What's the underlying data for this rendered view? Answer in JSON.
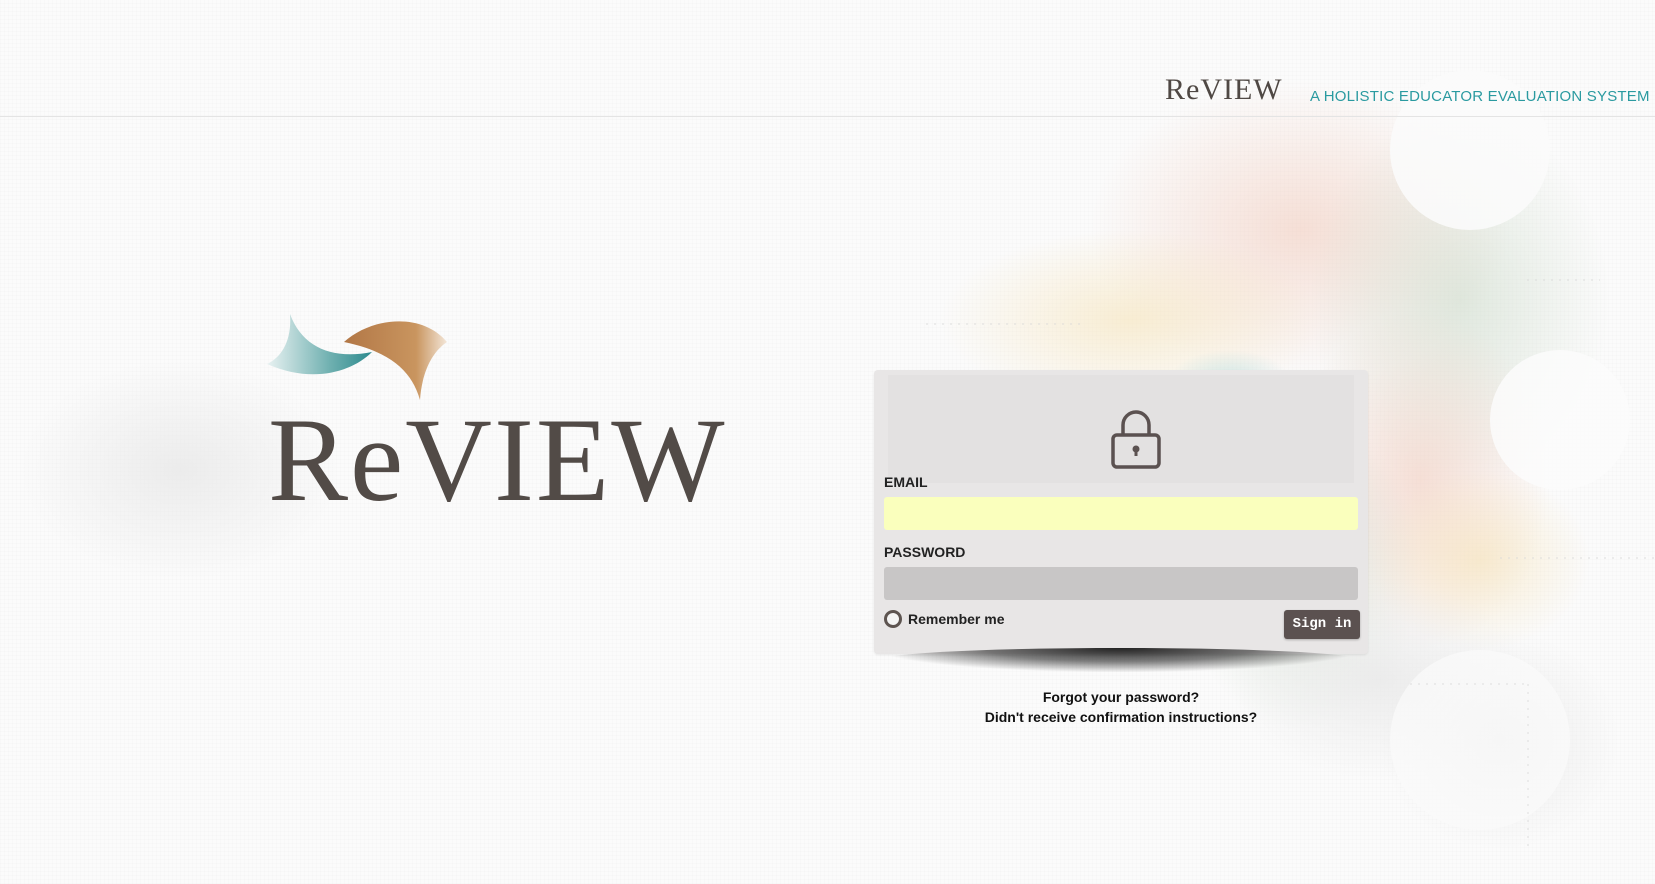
{
  "header": {
    "logo_text": "ReVIEW",
    "tagline": "A HOLISTIC EDUCATOR EVALUATION SYSTEM"
  },
  "hero": {
    "logo_text": "ReVIEW"
  },
  "login": {
    "email_label": "EMAIL",
    "email_value": "",
    "password_label": "PASSWORD",
    "password_value": "",
    "remember_label": "Remember me",
    "remember_checked": false,
    "signin_label": "Sign in"
  },
  "links": {
    "forgot_password": "Forgot your password?",
    "confirmation": "Didn't receive confirmation instructions?"
  },
  "colors": {
    "accent_teal": "#2a9aa0",
    "logo_brown": "#524b47",
    "button_bg": "#5b5150",
    "email_autofill_bg": "#faffbd"
  }
}
